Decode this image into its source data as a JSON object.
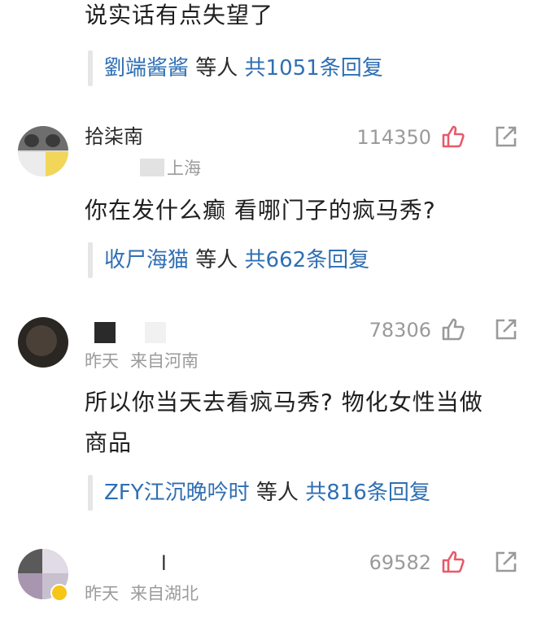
{
  "top": {
    "comment_text": "说实话有点失望了",
    "reply": {
      "names": "劉端酱酱",
      "mid": " 等人 ",
      "count": "共1051条回复"
    }
  },
  "comments": [
    {
      "username": "拾柒南",
      "location": "上海",
      "likes": "114350",
      "liked": true,
      "text": "你在发什么癫 看哪门子的疯马秀?",
      "reply": {
        "names": "收尸海猫",
        "mid": " 等人 ",
        "count": "共662条回复"
      }
    },
    {
      "username": "",
      "date": "昨天",
      "location": "来自河南",
      "likes": "78306",
      "liked": false,
      "text_line1": "所以你当天去看疯马秀? 物化女性当做",
      "text_line2": "商品",
      "reply": {
        "names": "ZFY江沉晚吟时",
        "mid": " 等人 ",
        "count": "共816条回复"
      }
    },
    {
      "username": "l",
      "date": "昨天",
      "location": "来自湖北",
      "likes": "69582",
      "liked": true
    }
  ],
  "colors": {
    "liked": "#e85a6a",
    "unliked": "#9a9a9a",
    "link": "#2f6fb3"
  },
  "icons": {
    "like": "thumbs-up-icon",
    "share": "share-icon"
  }
}
